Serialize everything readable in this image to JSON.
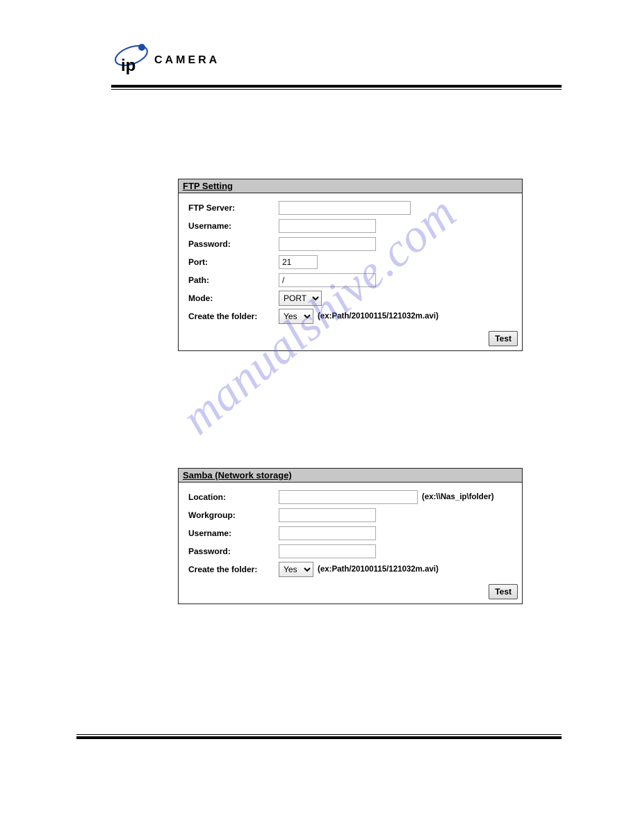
{
  "brand": {
    "text": "CAMERA"
  },
  "watermark": "manualshive.com",
  "ftp": {
    "title": "FTP Setting",
    "server_label": "FTP Server:",
    "server_value": "",
    "username_label": "Username:",
    "username_value": "",
    "password_label": "Password:",
    "password_value": "",
    "port_label": "Port:",
    "port_value": "21",
    "path_label": "Path:",
    "path_value": "/",
    "mode_label": "Mode:",
    "mode_value": "PORT",
    "createfolder_label": "Create the folder:",
    "createfolder_value": "Yes",
    "createfolder_hint": "(ex:Path/20100115/121032m.avi)",
    "test_label": "Test"
  },
  "samba": {
    "title": "Samba (Network storage)",
    "location_label": "Location:",
    "location_value": "",
    "location_hint": "(ex:\\\\Nas_ip\\folder)",
    "workgroup_label": "Workgroup:",
    "workgroup_value": "",
    "username_label": "Username:",
    "username_value": "",
    "password_label": "Password:",
    "password_value": "",
    "createfolder_label": "Create the folder:",
    "createfolder_value": "Yes",
    "createfolder_hint": "(ex:Path/20100115/121032m.avi)",
    "test_label": "Test"
  }
}
